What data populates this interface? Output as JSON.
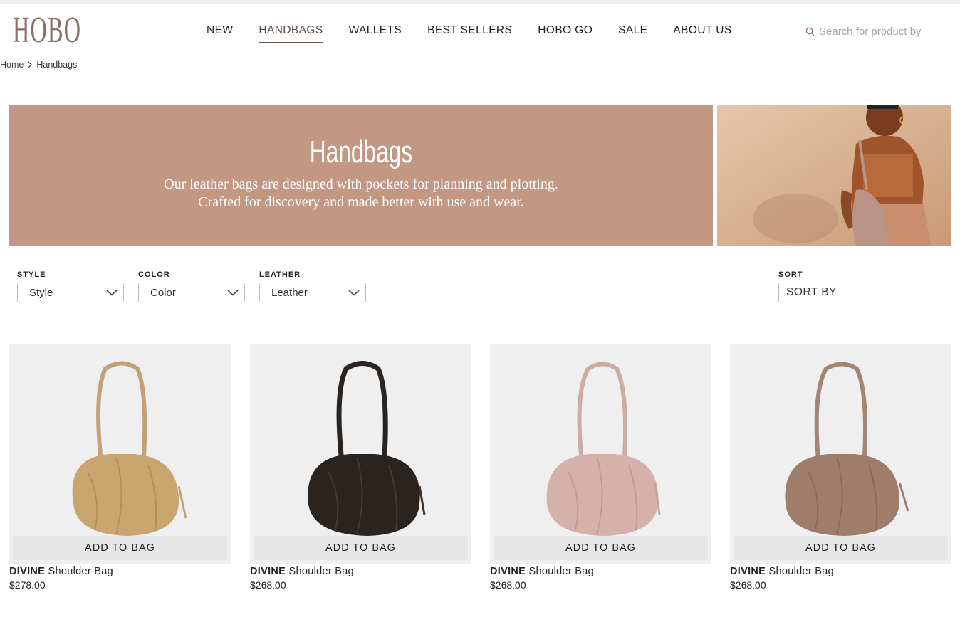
{
  "brand": {
    "logo_text": "HOBO",
    "logo_subtext": "HOBO"
  },
  "nav": {
    "items": [
      {
        "label": "NEW"
      },
      {
        "label": "HANDBAGS",
        "active": true
      },
      {
        "label": "WALLETS"
      },
      {
        "label": "BEST SELLERS"
      },
      {
        "label": "HOBO GO"
      },
      {
        "label": "SALE"
      },
      {
        "label": "ABOUT US"
      }
    ]
  },
  "search": {
    "placeholder": "Search for product by",
    "icon": "search-icon"
  },
  "breadcrumb": {
    "home": "Home",
    "current": "Handbags"
  },
  "hero": {
    "title": "Handbags",
    "line1": "Our leather bags are designed with pockets for planning and plotting.",
    "line2": "Crafted for discovery and made better with use and wear.",
    "bg_color": "#c29884"
  },
  "filters": {
    "style": {
      "label": "STYLE",
      "value": "Style"
    },
    "color": {
      "label": "COLOR",
      "value": "Color"
    },
    "leather": {
      "label": "LEATHER",
      "value": "Leather"
    },
    "sort": {
      "label": "SORT",
      "value": "SORT BY"
    }
  },
  "products": [
    {
      "brand": "DIVINE",
      "name": "Shoulder Bag",
      "price": "$278.00",
      "cta": "ADD TO BAG",
      "color": "#c9a56f"
    },
    {
      "brand": "DIVINE",
      "name": "Shoulder Bag",
      "price": "$268.00",
      "cta": "ADD TO BAG",
      "color": "#2a2421"
    },
    {
      "brand": "DIVINE",
      "name": "Shoulder Bag",
      "price": "$268.00",
      "cta": "ADD TO BAG",
      "color": "#d4b1ab"
    },
    {
      "brand": "DIVINE",
      "name": "Shoulder Bag",
      "price": "$268.00",
      "cta": "ADD TO BAG",
      "color": "#9e7d6b"
    }
  ]
}
